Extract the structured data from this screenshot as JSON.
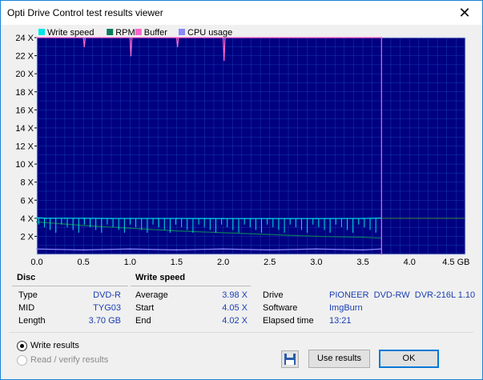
{
  "window": {
    "title": "Opti Drive Control test results viewer"
  },
  "chart": {
    "legend": [
      {
        "label": "Write speed",
        "color": "#00e5e5"
      },
      {
        "label": "RPM",
        "color": "#0b7a5c"
      },
      {
        "label": "Buffer",
        "color": "#ff66cc"
      },
      {
        "label": "CPU usage",
        "color": "#8888ff"
      }
    ],
    "y_ticks": [
      "24 X",
      "22 X",
      "20 X",
      "18 X",
      "16 X",
      "14 X",
      "12 X",
      "10 X",
      "8 X",
      "6 X",
      "4 X",
      "2 X"
    ],
    "x_ticks": [
      "0.0",
      "0.5",
      "1.0",
      "1.5",
      "2.0",
      "2.5",
      "3.0",
      "3.5",
      "4.0",
      "4.5 GB"
    ],
    "bg_color": "#000080",
    "grid_color": "#2b6bd6"
  },
  "chart_data": {
    "type": "line",
    "xlabel": "",
    "ylabel": "",
    "x_unit": "GB",
    "y_unit": "X",
    "xlim": [
      0,
      4.6
    ],
    "ylim": [
      0,
      24
    ],
    "grid": true,
    "legend_position": "top-left",
    "series": [
      {
        "name": "Write speed",
        "color": "#00e5e5",
        "x": [
          0.0,
          0.1,
          0.2,
          0.3,
          0.5,
          0.8,
          1.0,
          1.3,
          1.5,
          2.0,
          2.5,
          3.0,
          3.5,
          3.7
        ],
        "y": [
          4.05,
          4.0,
          4.0,
          4.0,
          4.0,
          3.98,
          3.98,
          3.98,
          3.98,
          3.97,
          3.97,
          3.97,
          3.98,
          4.02
        ]
      },
      {
        "name": "RPM",
        "color": "#0b7a5c",
        "x": [
          0.0,
          0.5,
          1.0,
          1.5,
          2.0,
          2.5,
          3.0,
          3.5,
          3.7
        ],
        "y": [
          3.6,
          3.2,
          2.9,
          2.6,
          2.4,
          2.2,
          2.0,
          1.9,
          1.8
        ]
      },
      {
        "name": "Buffer",
        "color": "#ff66cc",
        "x": [
          0.0,
          0.5,
          0.51,
          0.52,
          1.0,
          1.01,
          1.02,
          1.5,
          1.51,
          1.52,
          2.0,
          2.01,
          2.02,
          3.69,
          3.7,
          3.7
        ],
        "y": [
          24,
          24,
          23,
          24,
          24,
          22,
          24,
          24,
          23,
          24,
          24,
          21.5,
          24,
          24,
          24,
          0
        ]
      },
      {
        "name": "CPU usage",
        "color": "#8888ff",
        "x": [
          0.0,
          0.5,
          1.0,
          1.5,
          2.0,
          2.5,
          3.0,
          3.5,
          3.7
        ],
        "y": [
          0.6,
          0.5,
          0.6,
          0.5,
          0.6,
          0.5,
          0.6,
          0.5,
          0.6
        ]
      }
    ]
  },
  "disc": {
    "title": "Disc",
    "rows": [
      {
        "label": "Type",
        "value": "DVD-R"
      },
      {
        "label": "MID",
        "value": "TYG03"
      },
      {
        "label": "Length",
        "value": "3.70 GB"
      }
    ]
  },
  "write_speed": {
    "title": "Write speed",
    "rows": [
      {
        "label": "Average",
        "value": "3.98 X"
      },
      {
        "label": "Start",
        "value": "4.05 X"
      },
      {
        "label": "End",
        "value": "4.02 X"
      }
    ]
  },
  "drive_info": {
    "rows": [
      {
        "label": "Drive",
        "value": "PIONEER  DVD-RW  DVR-216L 1.10"
      },
      {
        "label": "Software",
        "value": "ImgBurn"
      },
      {
        "label": "Elapsed time",
        "value": "13:21"
      }
    ]
  },
  "options": {
    "write_results": "Write results",
    "read_verify": "Read / verify results"
  },
  "buttons": {
    "use_results": "Use results",
    "ok": "OK"
  }
}
